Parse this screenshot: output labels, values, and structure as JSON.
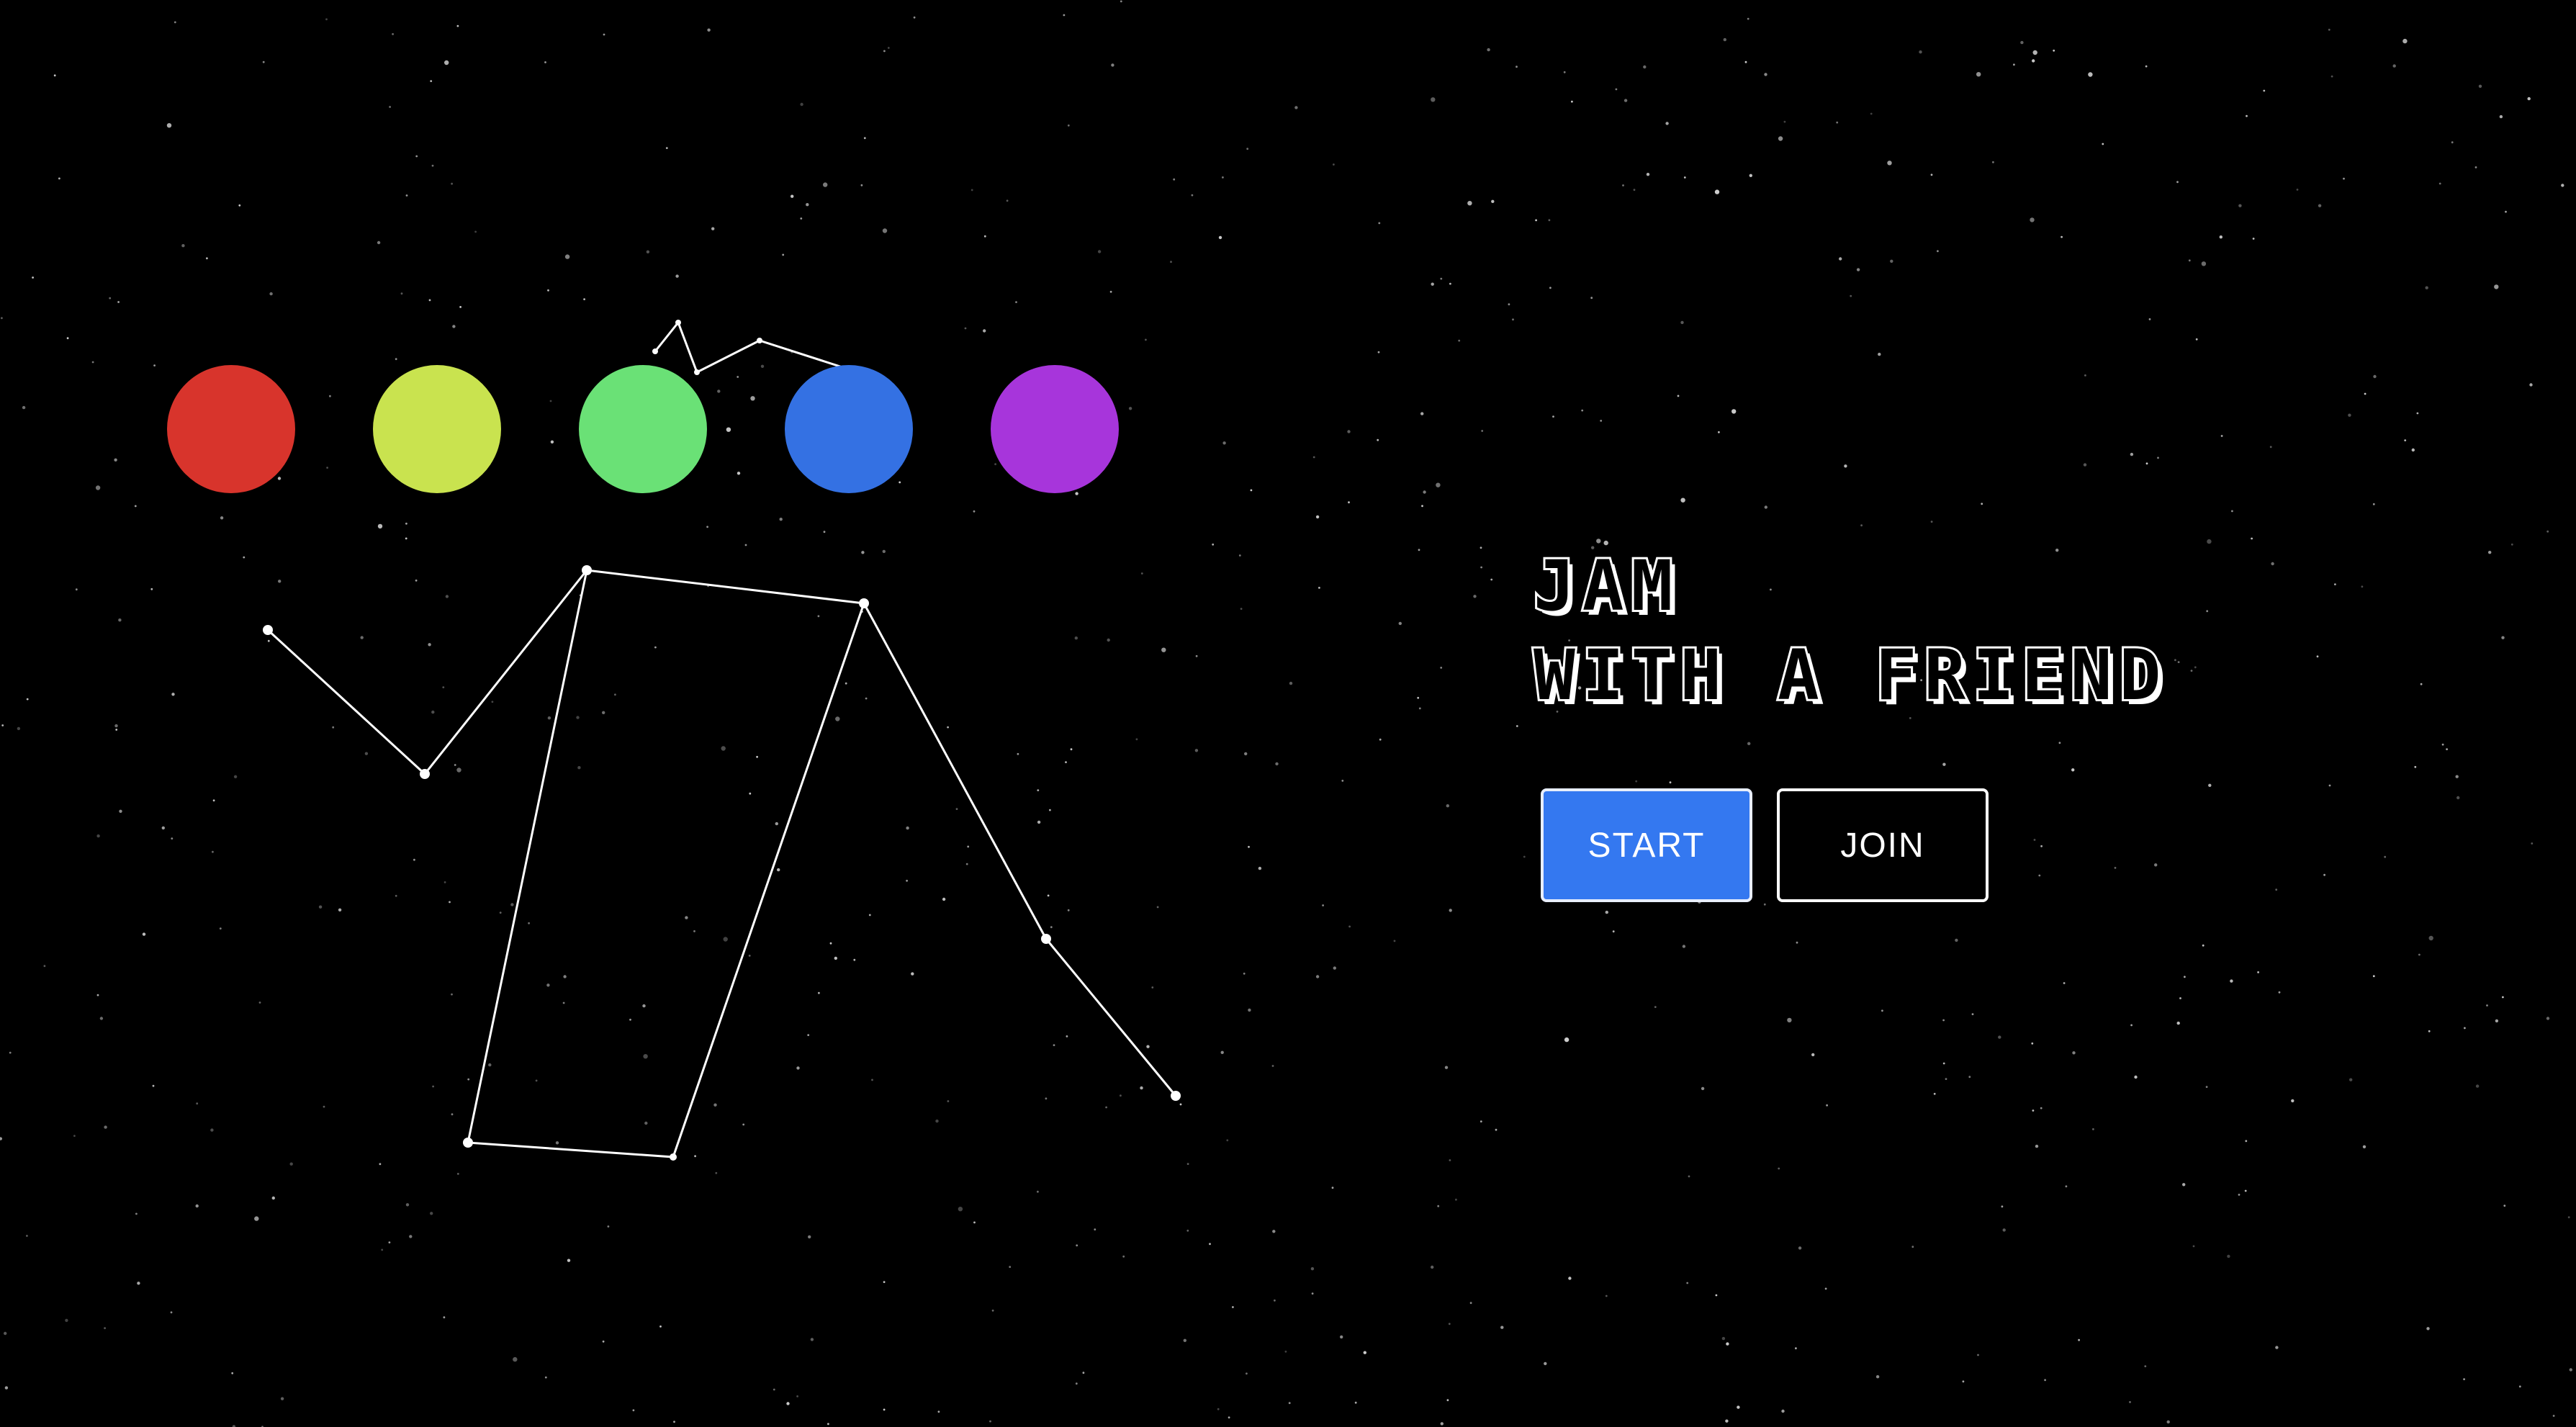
{
  "title": {
    "line1": "JAM",
    "line2": "WITH A FRIEND"
  },
  "buttons": {
    "start_label": "START",
    "join_label": "JOIN"
  },
  "colors": {
    "background": "#000000",
    "start_button": "#3478F0",
    "palette": [
      "#D8342C",
      "#C9E34F",
      "#6AE176",
      "#3471E3",
      "#A735DB"
    ]
  },
  "palette_circles": [
    {
      "name": "red",
      "color": "#D8342C"
    },
    {
      "name": "yellow-green",
      "color": "#C9E34F"
    },
    {
      "name": "green",
      "color": "#6AE176"
    },
    {
      "name": "blue",
      "color": "#3471E3"
    },
    {
      "name": "purple",
      "color": "#A735DB"
    }
  ]
}
